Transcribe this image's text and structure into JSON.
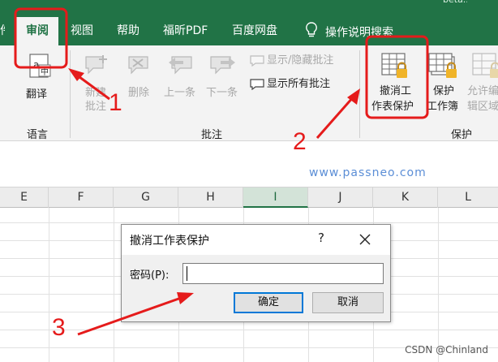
{
  "tabs": {
    "cut_label": "件",
    "top_cut_text": "beta...",
    "review": "审阅",
    "view": "视图",
    "help": "帮助",
    "foxit_pdf": "福昕PDF",
    "baidu_netdisk": "百度网盘",
    "search_help": "操作说明搜索"
  },
  "ribbon": {
    "translate": "翻译",
    "language_group": "语言",
    "new_comment_l1": "新建",
    "new_comment_l2": "批注",
    "delete": "删除",
    "previous": "上一条",
    "next": "下一条",
    "show_hide_comment": "显示/隐藏批注",
    "show_all_comments": "显示所有批注",
    "comments_group": "批注",
    "unprotect_sheet_l1": "撤消工",
    "unprotect_sheet_l2": "作表保护",
    "protect_workbook_l1": "保护",
    "protect_workbook_l2": "工作簿",
    "allow_edit_l1": "允许编",
    "allow_edit_l2": "辑区域",
    "protect_group": "保护"
  },
  "watermark": "www.passneo.com",
  "columns": [
    "E",
    "F",
    "G",
    "H",
    "I",
    "J",
    "K",
    "L"
  ],
  "selected_column": "I",
  "dialog": {
    "title": "撤消工作表保护",
    "help": "?",
    "password_label": "密码(P):",
    "password_value": "",
    "ok": "确定",
    "cancel": "取消"
  },
  "annotations": [
    "1",
    "2",
    "3"
  ],
  "credit": "CSDN @Chinland",
  "colors": {
    "excel_green": "#217346",
    "annotation_red": "#e51b1b",
    "watermark_blue": "#5b8ed6",
    "focus_blue": "#0078d7"
  }
}
